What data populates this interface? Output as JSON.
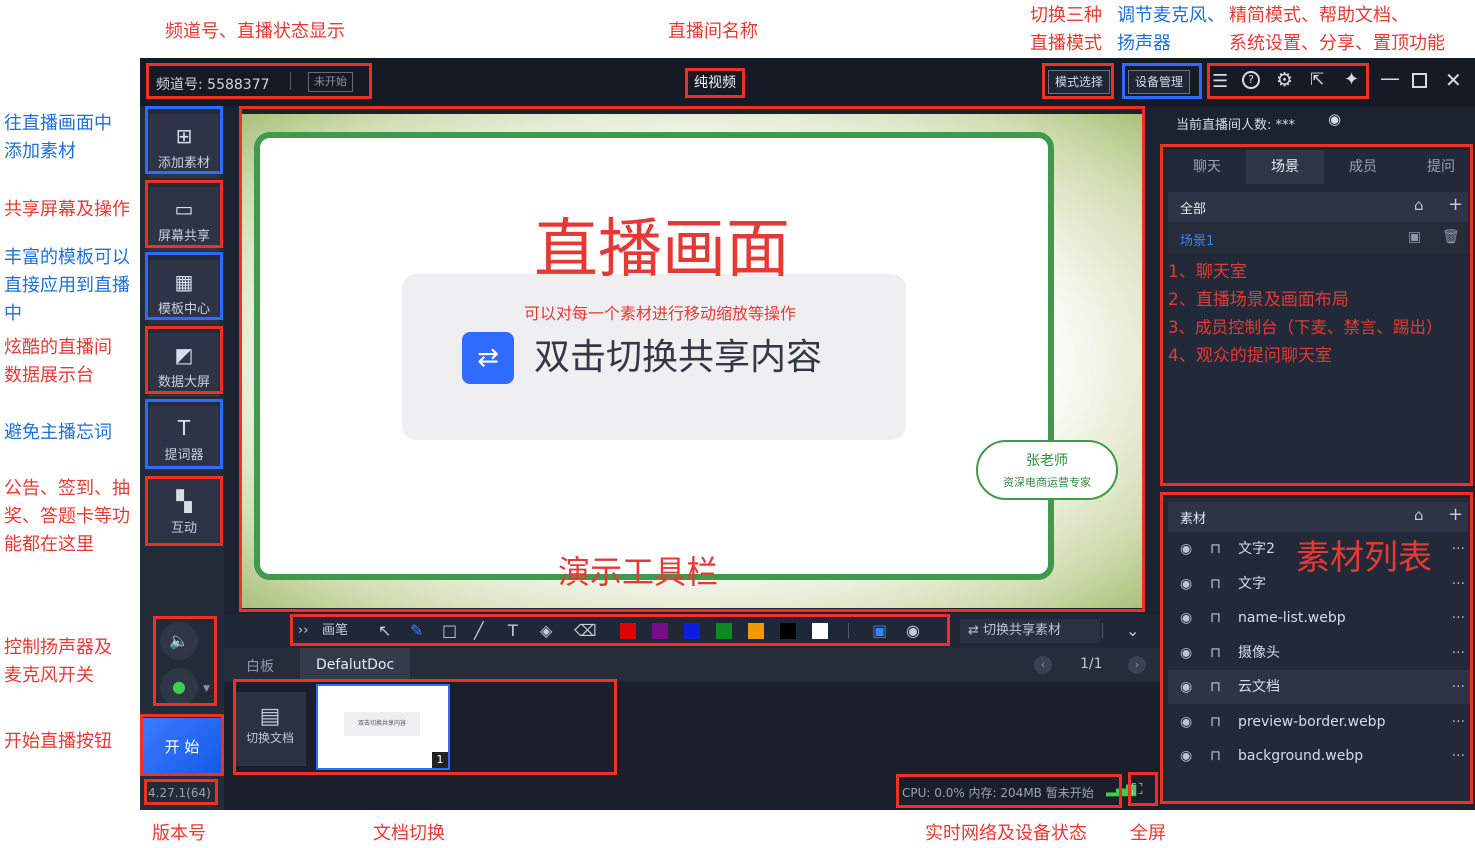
{
  "annotations": {
    "channel_status": "频道号、直播状态显示",
    "room_name": "直播间名称",
    "mode_switch_1": "切换三种",
    "mode_switch_2": "直播模式",
    "device_1": "调节麦克风、",
    "device_2": "扬声器",
    "tools_1": "精简模式、帮助文档、",
    "tools_2": "系统设置、分享、置顶功能",
    "add_material_1": "往直播画面中",
    "add_material_2": "添加素材",
    "screen_share": "共享屏幕及操作",
    "template_1": "丰富的模板可以",
    "template_2": "直接应用到直播",
    "template_3": "中",
    "data_screen_1": "炫酷的直播间",
    "data_screen_2": "数据展示台",
    "prompter": "避免主播忘词",
    "interact_1": "公告、签到、抽",
    "interact_2": "奖、答题卡等功",
    "interact_3": "能都在这里",
    "audio_1": "控制扬声器及",
    "audio_2": "麦克风开关",
    "start": "开始直播按钮",
    "version": "版本号",
    "doc_switch": "文档切换",
    "net_status": "实时网络及设备状态",
    "fullscreen": "全屏",
    "live_view": "直播画面",
    "toolbar": "演示工具栏",
    "material_list": "素材列表",
    "scene_notes": [
      "1、聊天室",
      "2、直播场景及画面布局",
      "3、成员控制台（下麦、禁言、踢出）",
      "4、观众的提问聊天室"
    ]
  },
  "titlebar": {
    "channel": "频道号: 5588377",
    "status": "未开始",
    "room_name": "纯视频",
    "mode_btn": "模式选择",
    "device_btn": "设备管理"
  },
  "sidebar": {
    "items": [
      {
        "label": "添加素材",
        "icon": "add-material-icon"
      },
      {
        "label": "屏幕共享",
        "icon": "screen-share-icon"
      },
      {
        "label": "模板中心",
        "icon": "template-icon"
      },
      {
        "label": "数据大屏",
        "icon": "data-screen-icon"
      },
      {
        "label": "提词器",
        "icon": "prompter-icon"
      },
      {
        "label": "互动",
        "icon": "interact-icon"
      }
    ],
    "start": "开 始",
    "version": "4.27.1(64)"
  },
  "canvas": {
    "hint": "可以对每一个素材进行移动缩放等操作",
    "share": "双击切换共享内容",
    "teacher_name": "张老师",
    "teacher_title": "资深电商运营专家"
  },
  "draw_toolbar": {
    "pen": "画笔",
    "switch_material": "切换共享素材",
    "colors": [
      "#e00000",
      "#7a0b8a",
      "#0a1ee0",
      "#0a8a1e",
      "#f29a00",
      "#000000",
      "#ffffff"
    ]
  },
  "docs": {
    "tab_whiteboard": "白板",
    "tab_doc": "DefalutDoc",
    "page": "1/1",
    "switch_doc": "切换文档",
    "thumb_text": "双击切换共享内容",
    "thumb_num": "1"
  },
  "status_bar": {
    "text": "CPU: 0.0%  内存: 204MB  暂未开始"
  },
  "right_panel": {
    "viewers": "当前直播间人数: ***",
    "tabs": [
      "聊天",
      "场景",
      "成员",
      "提问"
    ],
    "all": "全部",
    "scene1": "场景1",
    "material_header": "素材",
    "materials": [
      "文字2",
      "文字",
      "name-list.webp",
      "摄像头",
      "云文档",
      "preview-border.webp",
      "background.webp"
    ]
  }
}
